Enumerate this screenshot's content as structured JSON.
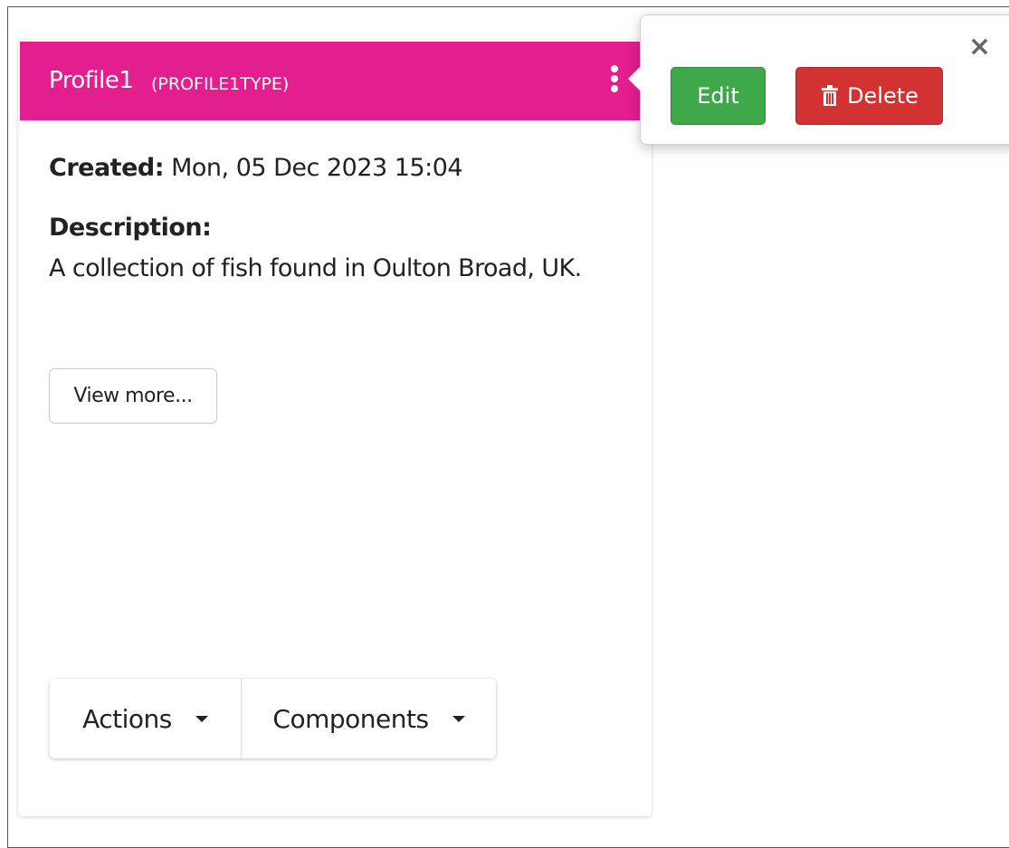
{
  "card": {
    "title": "Profile1",
    "type": "(PROFILE1TYPE)",
    "header_color": "#e31e8e",
    "created_label": "Created:",
    "created_value": "Mon, 05 Dec 2023 15:04",
    "description_label": "Description:",
    "description_text": "A collection of fish found in Oulton Broad, UK.",
    "view_more_label": "View more..."
  },
  "button_group": {
    "actions_label": "Actions",
    "components_label": "Components"
  },
  "popover": {
    "close_symbol": "×",
    "edit_label": "Edit",
    "delete_label": "Delete",
    "edit_color": "#3fa84a",
    "delete_color": "#d23232"
  }
}
